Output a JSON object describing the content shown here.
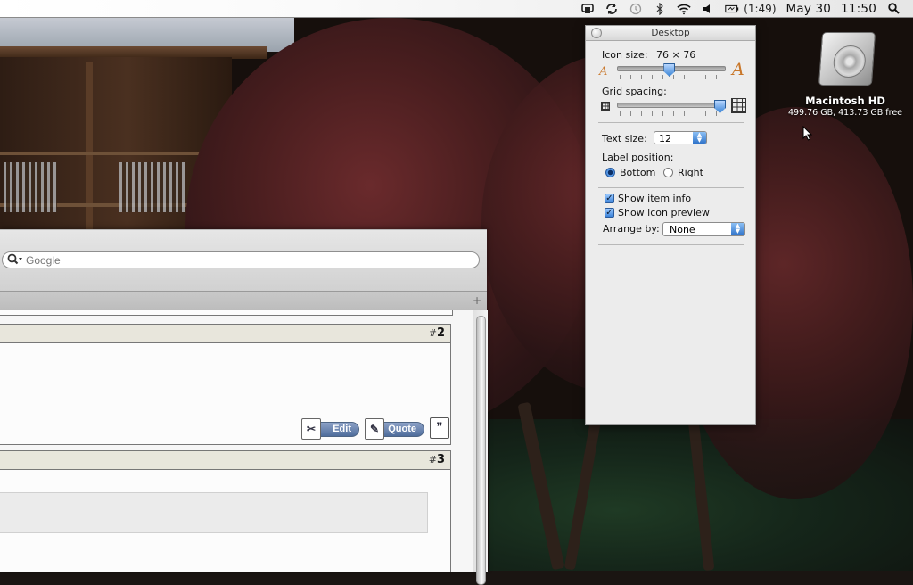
{
  "menubar": {
    "battery_time": "(1:49)",
    "date": "May 30",
    "time": "11:50",
    "icons": [
      "time-capsule-icon",
      "sync-icon",
      "time-machine-icon",
      "bluetooth-icon",
      "wifi-icon",
      "volume-icon",
      "battery-icon",
      "spotlight-icon"
    ]
  },
  "view_options": {
    "title": "Desktop",
    "icon_size_label": "Icon size:",
    "icon_size_value": "76 × 76",
    "icon_size_level": 0.48,
    "grid_spacing_label": "Grid spacing:",
    "grid_spacing_level": 1.0,
    "text_size_label": "Text size:",
    "text_size_value": "12",
    "label_position_label": "Label position:",
    "label_position_options": [
      "Bottom",
      "Right"
    ],
    "label_position_selected": "Bottom",
    "show_item_info_label": "Show item info",
    "show_item_info": true,
    "show_icon_preview_label": "Show icon preview",
    "show_icon_preview": true,
    "arrange_by_label": "Arrange by:",
    "arrange_by_value": "None"
  },
  "desktop_items": [
    {
      "name": "Macintosh HD",
      "info": "499.76 GB, 413.73 GB free"
    }
  ],
  "browser": {
    "search_placeholder": "Google",
    "posts": [
      {
        "number": "2",
        "buttons": [
          "Edit",
          "Quote"
        ]
      },
      {
        "number": "3"
      }
    ]
  },
  "colors": {
    "accent_blue": "#3d86d6",
    "post_header": "#e8e6dc",
    "button_blue": "#5a78a8"
  }
}
